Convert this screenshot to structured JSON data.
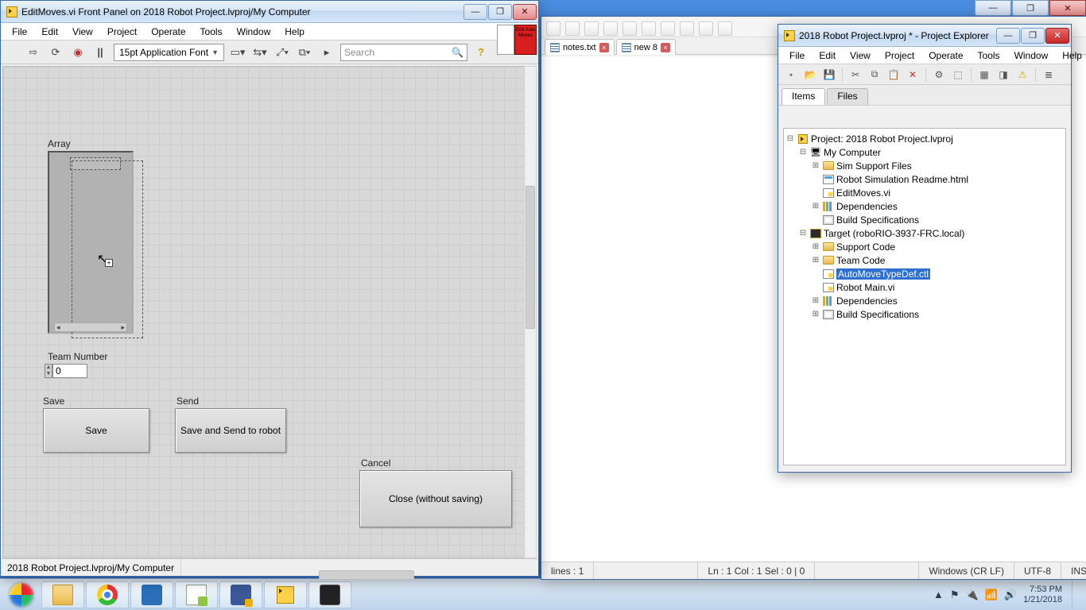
{
  "backgroundWindow": {
    "winbtns": {
      "min": "—",
      "max": "❐",
      "close": "✕"
    }
  },
  "notepadpp": {
    "toolbar_count": 24,
    "tabs": [
      {
        "label": "notes.txt",
        "active": false
      },
      {
        "label": "new 8",
        "active": true
      }
    ],
    "status": {
      "lines": "lines : 1",
      "pos": "Ln : 1    Col : 1    Sel : 0 | 0",
      "eol": "Windows (CR LF)",
      "enc": "UTF-8",
      "mode": "INS"
    }
  },
  "frontPanel": {
    "title": "EditMoves.vi Front Panel on 2018 Robot Project.lvproj/My Computer",
    "menus": [
      "File",
      "Edit",
      "View",
      "Project",
      "Operate",
      "Tools",
      "Window",
      "Help"
    ],
    "font": "15pt Application Font",
    "searchPlaceholder": "Search",
    "cornerBadge": "Edit Auto Moves",
    "arrayLabel": "Array",
    "teamNumberLabel": "Team Number",
    "teamNumberValue": "0",
    "groups": {
      "save": "Save",
      "send": "Send",
      "cancel": "Cancel"
    },
    "buttons": {
      "save": "Save",
      "send": "Save and Send to robot",
      "cancel": "Close (without saving)"
    },
    "statusPath": "2018 Robot Project.lvproj/My Computer"
  },
  "projectExplorer": {
    "title": "2018 Robot Project.lvproj * - Project Explorer",
    "menus": [
      "File",
      "Edit",
      "View",
      "Project",
      "Operate",
      "Tools",
      "Window",
      "Help"
    ],
    "tabs": {
      "items": "Items",
      "files": "Files"
    },
    "tree": {
      "root": "Project: 2018 Robot Project.lvproj",
      "myComputer": "My Computer",
      "sim": "Sim Support Files",
      "readme": "Robot Simulation Readme.html",
      "editmoves": "EditMoves.vi",
      "dep1": "Dependencies",
      "build1": "Build Specifications",
      "target": "Target (roboRIO-3937-FRC.local)",
      "support": "Support Code",
      "team": "Team Code",
      "automove": "AutoMoveTypeDef.ctl",
      "robotmain": "Robot Main.vi",
      "dep2": "Dependencies",
      "build2": "Build Specifications"
    }
  },
  "taskbar": {
    "time": "7:53 PM",
    "date": "1/21/2018"
  }
}
